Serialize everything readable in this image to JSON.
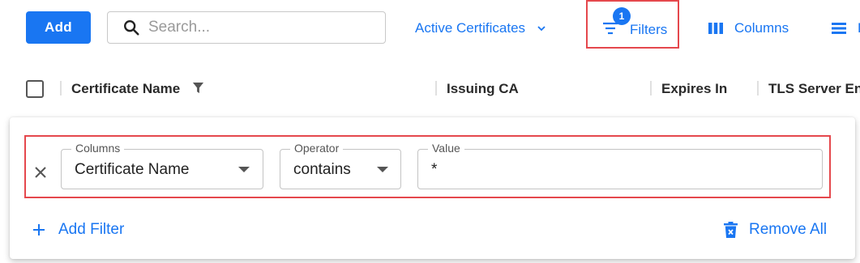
{
  "toolbar": {
    "add_label": "Add",
    "search_placeholder": "Search...",
    "view_label": "Active Certificates",
    "filters_label": "Filters",
    "filters_badge": "1",
    "columns_label": "Columns",
    "density_label": "D"
  },
  "table": {
    "headers": [
      "Certificate Name",
      "Issuing CA",
      "Expires In",
      "TLS Server En"
    ]
  },
  "filter_panel": {
    "rows": [
      {
        "column_label": "Columns",
        "column_value": "Certificate Name",
        "operator_label": "Operator",
        "operator_value": "contains",
        "value_label": "Value",
        "value_value": "*"
      }
    ],
    "add_filter_label": "Add Filter",
    "remove_all_label": "Remove All"
  },
  "colors": {
    "accent": "#1976f2",
    "highlight": "#e5484d"
  }
}
